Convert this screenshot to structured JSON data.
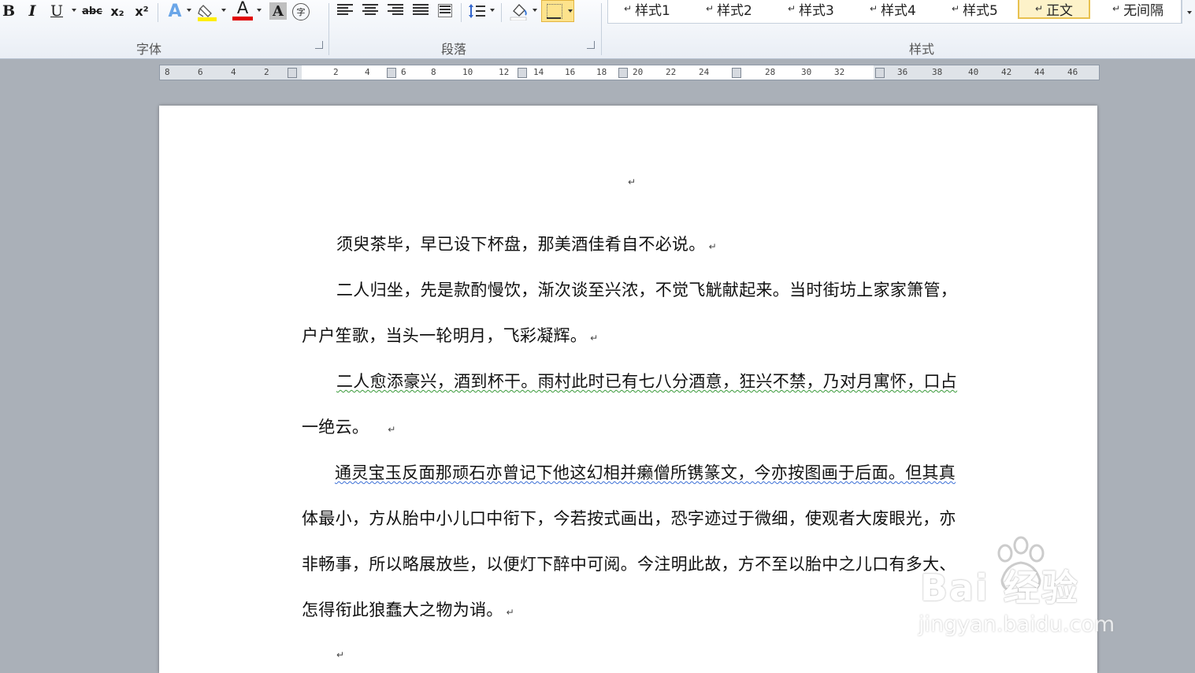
{
  "ribbon": {
    "font_group": {
      "label": "字体",
      "bold": "B",
      "italic": "I",
      "underline": "U",
      "strikethrough": "abc",
      "subscript": "x₂",
      "superscript": "x²",
      "text_effects": "A",
      "font_color": "A",
      "char_shading": "A",
      "enclose": "字",
      "font_color_bar": "#e00000",
      "highlight_color_bar": "#ffee00"
    },
    "paragraph_group": {
      "label": "段落"
    },
    "styles_group": {
      "label": "样式",
      "items": [
        "样式1",
        "样式2",
        "样式3",
        "样式4",
        "样式5",
        "正文",
        "无间隔"
      ],
      "selected": "正文",
      "selected_style": "正文",
      "pilcrow": "↵"
    }
  },
  "ruler": {
    "numbers": [
      "8",
      "6",
      "4",
      "2",
      "2",
      "4",
      "6",
      "8",
      "10",
      "12",
      "14",
      "16",
      "18",
      "20",
      "22",
      "24",
      "28",
      "30",
      "32",
      "36",
      "38",
      "40",
      "42",
      "44",
      "46"
    ]
  },
  "document": {
    "header_mark": "↵",
    "lines": [
      "须臾茶毕，早已设下杯盘，那美酒佳肴自不必说。",
      "二人归坐，先是款酌慢饮，渐次谈至兴浓，不觉飞觥献起来。当时街坊上家家箫管，",
      "户户笙歌，当头一轮明月，飞彩凝辉。",
      "二人愈添豪兴，酒到杯干。雨村此时已有七八分酒意，狂兴不禁，乃对月寓怀，口占",
      "一绝云。",
      "通灵宝玉反面那顽石亦曾记下他这幻相并癞僧所镌篆文，今亦按图画于后面。但其真",
      "体最小，方从胎中小儿口中衔下，今若按式画出，恐字迹过于微细，使观者大废眼光，亦",
      "非畅事，所以略展放些，以便灯下醉中可阅。今注明此故，方不至以胎中之儿口有多大、",
      "怎得衔此狼蠢大之物为诮。"
    ],
    "trailing_mark": "↵"
  },
  "watermark": {
    "logo": "Bai 经验",
    "url": "jingyan.baidu.com"
  },
  "colors": {
    "ribbon_bg": "#e9eef5",
    "workspace_bg": "#aab0b8",
    "selected_style_border": "#e8c150"
  }
}
